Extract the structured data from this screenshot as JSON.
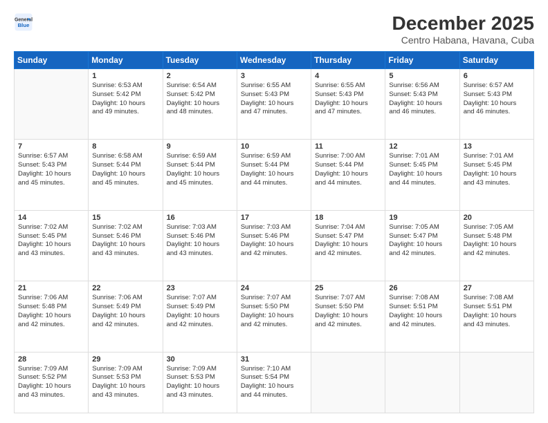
{
  "header": {
    "logo_line1": "General",
    "logo_line2": "Blue",
    "title": "December 2025",
    "subtitle": "Centro Habana, Havana, Cuba"
  },
  "days_of_week": [
    "Sunday",
    "Monday",
    "Tuesday",
    "Wednesday",
    "Thursday",
    "Friday",
    "Saturday"
  ],
  "weeks": [
    [
      {
        "day": "",
        "text": ""
      },
      {
        "day": "1",
        "text": "Sunrise: 6:53 AM\nSunset: 5:42 PM\nDaylight: 10 hours\nand 49 minutes."
      },
      {
        "day": "2",
        "text": "Sunrise: 6:54 AM\nSunset: 5:42 PM\nDaylight: 10 hours\nand 48 minutes."
      },
      {
        "day": "3",
        "text": "Sunrise: 6:55 AM\nSunset: 5:43 PM\nDaylight: 10 hours\nand 47 minutes."
      },
      {
        "day": "4",
        "text": "Sunrise: 6:55 AM\nSunset: 5:43 PM\nDaylight: 10 hours\nand 47 minutes."
      },
      {
        "day": "5",
        "text": "Sunrise: 6:56 AM\nSunset: 5:43 PM\nDaylight: 10 hours\nand 46 minutes."
      },
      {
        "day": "6",
        "text": "Sunrise: 6:57 AM\nSunset: 5:43 PM\nDaylight: 10 hours\nand 46 minutes."
      }
    ],
    [
      {
        "day": "7",
        "text": "Sunrise: 6:57 AM\nSunset: 5:43 PM\nDaylight: 10 hours\nand 45 minutes."
      },
      {
        "day": "8",
        "text": "Sunrise: 6:58 AM\nSunset: 5:44 PM\nDaylight: 10 hours\nand 45 minutes."
      },
      {
        "day": "9",
        "text": "Sunrise: 6:59 AM\nSunset: 5:44 PM\nDaylight: 10 hours\nand 45 minutes."
      },
      {
        "day": "10",
        "text": "Sunrise: 6:59 AM\nSunset: 5:44 PM\nDaylight: 10 hours\nand 44 minutes."
      },
      {
        "day": "11",
        "text": "Sunrise: 7:00 AM\nSunset: 5:44 PM\nDaylight: 10 hours\nand 44 minutes."
      },
      {
        "day": "12",
        "text": "Sunrise: 7:01 AM\nSunset: 5:45 PM\nDaylight: 10 hours\nand 44 minutes."
      },
      {
        "day": "13",
        "text": "Sunrise: 7:01 AM\nSunset: 5:45 PM\nDaylight: 10 hours\nand 43 minutes."
      }
    ],
    [
      {
        "day": "14",
        "text": "Sunrise: 7:02 AM\nSunset: 5:45 PM\nDaylight: 10 hours\nand 43 minutes."
      },
      {
        "day": "15",
        "text": "Sunrise: 7:02 AM\nSunset: 5:46 PM\nDaylight: 10 hours\nand 43 minutes."
      },
      {
        "day": "16",
        "text": "Sunrise: 7:03 AM\nSunset: 5:46 PM\nDaylight: 10 hours\nand 43 minutes."
      },
      {
        "day": "17",
        "text": "Sunrise: 7:03 AM\nSunset: 5:46 PM\nDaylight: 10 hours\nand 42 minutes."
      },
      {
        "day": "18",
        "text": "Sunrise: 7:04 AM\nSunset: 5:47 PM\nDaylight: 10 hours\nand 42 minutes."
      },
      {
        "day": "19",
        "text": "Sunrise: 7:05 AM\nSunset: 5:47 PM\nDaylight: 10 hours\nand 42 minutes."
      },
      {
        "day": "20",
        "text": "Sunrise: 7:05 AM\nSunset: 5:48 PM\nDaylight: 10 hours\nand 42 minutes."
      }
    ],
    [
      {
        "day": "21",
        "text": "Sunrise: 7:06 AM\nSunset: 5:48 PM\nDaylight: 10 hours\nand 42 minutes."
      },
      {
        "day": "22",
        "text": "Sunrise: 7:06 AM\nSunset: 5:49 PM\nDaylight: 10 hours\nand 42 minutes."
      },
      {
        "day": "23",
        "text": "Sunrise: 7:07 AM\nSunset: 5:49 PM\nDaylight: 10 hours\nand 42 minutes."
      },
      {
        "day": "24",
        "text": "Sunrise: 7:07 AM\nSunset: 5:50 PM\nDaylight: 10 hours\nand 42 minutes."
      },
      {
        "day": "25",
        "text": "Sunrise: 7:07 AM\nSunset: 5:50 PM\nDaylight: 10 hours\nand 42 minutes."
      },
      {
        "day": "26",
        "text": "Sunrise: 7:08 AM\nSunset: 5:51 PM\nDaylight: 10 hours\nand 42 minutes."
      },
      {
        "day": "27",
        "text": "Sunrise: 7:08 AM\nSunset: 5:51 PM\nDaylight: 10 hours\nand 43 minutes."
      }
    ],
    [
      {
        "day": "28",
        "text": "Sunrise: 7:09 AM\nSunset: 5:52 PM\nDaylight: 10 hours\nand 43 minutes."
      },
      {
        "day": "29",
        "text": "Sunrise: 7:09 AM\nSunset: 5:53 PM\nDaylight: 10 hours\nand 43 minutes."
      },
      {
        "day": "30",
        "text": "Sunrise: 7:09 AM\nSunset: 5:53 PM\nDaylight: 10 hours\nand 43 minutes."
      },
      {
        "day": "31",
        "text": "Sunrise: 7:10 AM\nSunset: 5:54 PM\nDaylight: 10 hours\nand 44 minutes."
      },
      {
        "day": "",
        "text": ""
      },
      {
        "day": "",
        "text": ""
      },
      {
        "day": "",
        "text": ""
      }
    ]
  ]
}
